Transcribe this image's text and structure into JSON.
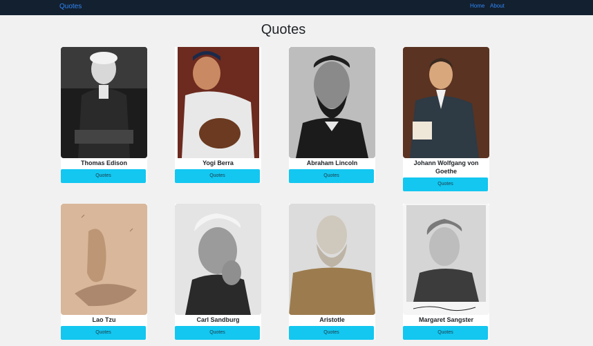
{
  "nav": {
    "brand": "Quotes",
    "links": [
      "Home",
      "About"
    ]
  },
  "page": {
    "title": "Quotes"
  },
  "people": [
    {
      "name": "Thomas Edison",
      "button": "Quotes"
    },
    {
      "name": "Yogi Berra",
      "button": "Quotes"
    },
    {
      "name": "Abraham Lincoln",
      "button": "Quotes"
    },
    {
      "name": "Johann Wolfgang von Goethe",
      "button": "Quotes"
    },
    {
      "name": "Lao Tzu",
      "button": "Quotes"
    },
    {
      "name": "Carl Sandburg",
      "button": "Quotes"
    },
    {
      "name": "Aristotle",
      "button": "Quotes"
    },
    {
      "name": "Margaret Sangster",
      "button": "Quotes"
    }
  ],
  "colors": {
    "navbar": "#13202f",
    "link": "#2f86f6",
    "button": "#13c7f0",
    "background": "#f1f1f1"
  }
}
